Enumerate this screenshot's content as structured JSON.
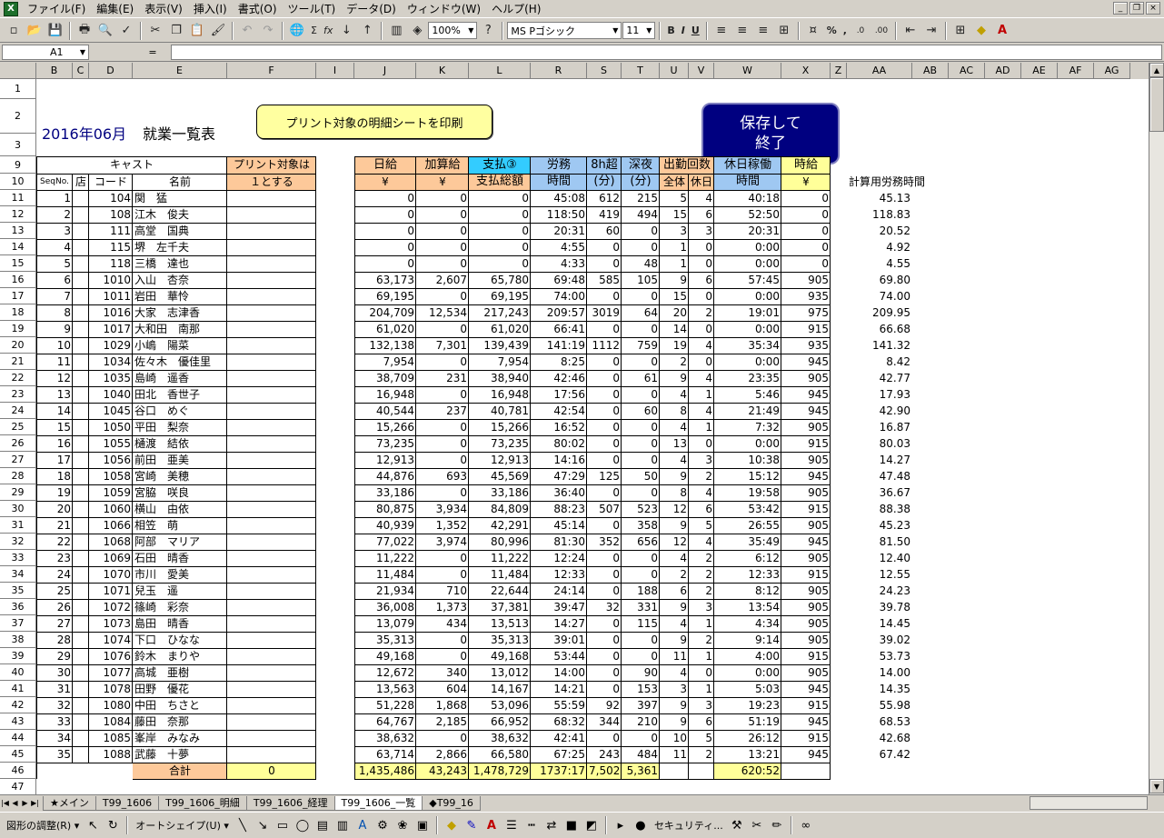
{
  "app": {
    "icon": "excel-app-icon"
  },
  "menu": [
    "ファイル(F)",
    "編集(E)",
    "表示(V)",
    "挿入(I)",
    "書式(O)",
    "ツール(T)",
    "データ(D)",
    "ウィンドウ(W)",
    "ヘルプ(H)"
  ],
  "window_controls": [
    "_",
    "❐",
    "×"
  ],
  "toolbar": {
    "zoom": "100%",
    "font": "MS Pゴシック",
    "size": "11",
    "bold": "B",
    "italic": "I",
    "underline": "U",
    "percent": "%",
    "comma": ",",
    "sigma": "Σ",
    "fx": "fx",
    "help": "?"
  },
  "formula_bar": {
    "name_box": "A1",
    "equals": "="
  },
  "columns": [
    "B",
    "C",
    "D",
    "E",
    "F",
    "I",
    "J",
    "K",
    "L",
    "R",
    "S",
    "T",
    "U",
    "V",
    "W",
    "X",
    "Z",
    "AA",
    "AB",
    "AC",
    "AD",
    "AE",
    "AF",
    "AG"
  ],
  "rows": [
    "1",
    "2",
    "3",
    "9",
    "10",
    "11",
    "12",
    "13",
    "14",
    "15",
    "16",
    "17",
    "18",
    "19",
    "20",
    "21",
    "22",
    "23",
    "24",
    "25",
    "26",
    "27",
    "28",
    "29",
    "30",
    "31",
    "32",
    "33",
    "34",
    "35",
    "36",
    "37",
    "38",
    "39",
    "40",
    "41",
    "42",
    "43",
    "44",
    "45",
    "46",
    "47"
  ],
  "title": {
    "date": "2016年06月",
    "label": "就業一覧表"
  },
  "print_button": "プリント対象の明細シートを印刷",
  "save_button": {
    "line1": "保存して",
    "line2": "終了"
  },
  "headers": {
    "cast": "キャスト",
    "seq": "SeqNo.",
    "store": "店",
    "code": "コード",
    "name": "名前",
    "print1": "プリント対象は",
    "print2": "１とする",
    "daily1": "日給",
    "daily2": "¥",
    "add1": "加算給",
    "add2": "¥",
    "pay1": "支払③",
    "pay2": "支払総額",
    "labor1": "労務",
    "labor2": "時間",
    "over1": "8h超",
    "over2": "(分)",
    "night1": "深夜",
    "night2": "(分)",
    "att1": "出勤回数",
    "att_all": "全体",
    "att_hol": "休日",
    "holwork1": "休日稼働",
    "holwork2": "時間",
    "hourly1": "時給",
    "hourly2": "¥",
    "calc": "計算用労務時間"
  },
  "table_rows": [
    {
      "seq": "1",
      "code": "104",
      "name": "関　猛",
      "daily": "0",
      "add": "0",
      "pay": "0",
      "labor": "45:08",
      "over": "612",
      "night": "215",
      "all": "5",
      "hol": "4",
      "holwork": "40:18",
      "hourly": "0",
      "calc": "45.13"
    },
    {
      "seq": "2",
      "code": "108",
      "name": "江木　俊夫",
      "daily": "0",
      "add": "0",
      "pay": "0",
      "labor": "118:50",
      "over": "419",
      "night": "494",
      "all": "15",
      "hol": "6",
      "holwork": "52:50",
      "hourly": "0",
      "calc": "118.83"
    },
    {
      "seq": "3",
      "code": "111",
      "name": "高堂　国典",
      "daily": "0",
      "add": "0",
      "pay": "0",
      "labor": "20:31",
      "over": "60",
      "night": "0",
      "all": "3",
      "hol": "3",
      "holwork": "20:31",
      "hourly": "0",
      "calc": "20.52"
    },
    {
      "seq": "4",
      "code": "115",
      "name": "堺　左千夫",
      "daily": "0",
      "add": "0",
      "pay": "0",
      "labor": "4:55",
      "over": "0",
      "night": "0",
      "all": "1",
      "hol": "0",
      "holwork": "0:00",
      "hourly": "0",
      "calc": "4.92"
    },
    {
      "seq": "5",
      "code": "118",
      "name": "三橋　達也",
      "daily": "0",
      "add": "0",
      "pay": "0",
      "labor": "4:33",
      "over": "0",
      "night": "48",
      "all": "1",
      "hol": "0",
      "holwork": "0:00",
      "hourly": "0",
      "calc": "4.55"
    },
    {
      "seq": "6",
      "code": "1010",
      "name": "入山　杏奈",
      "daily": "63,173",
      "add": "2,607",
      "pay": "65,780",
      "labor": "69:48",
      "over": "585",
      "night": "105",
      "all": "9",
      "hol": "6",
      "holwork": "57:45",
      "hourly": "905",
      "calc": "69.80"
    },
    {
      "seq": "7",
      "code": "1011",
      "name": "岩田　華怜",
      "daily": "69,195",
      "add": "0",
      "pay": "69,195",
      "labor": "74:00",
      "over": "0",
      "night": "0",
      "all": "15",
      "hol": "0",
      "holwork": "0:00",
      "hourly": "935",
      "calc": "74.00"
    },
    {
      "seq": "8",
      "code": "1016",
      "name": "大家　志津香",
      "daily": "204,709",
      "add": "12,534",
      "pay": "217,243",
      "labor": "209:57",
      "over": "3019",
      "night": "64",
      "all": "20",
      "hol": "2",
      "holwork": "19:01",
      "hourly": "975",
      "calc": "209.95"
    },
    {
      "seq": "9",
      "code": "1017",
      "name": "大和田　南那",
      "daily": "61,020",
      "add": "0",
      "pay": "61,020",
      "labor": "66:41",
      "over": "0",
      "night": "0",
      "all": "14",
      "hol": "0",
      "holwork": "0:00",
      "hourly": "915",
      "calc": "66.68"
    },
    {
      "seq": "10",
      "code": "1029",
      "name": "小嶋　陽菜",
      "daily": "132,138",
      "add": "7,301",
      "pay": "139,439",
      "labor": "141:19",
      "over": "1112",
      "night": "759",
      "all": "19",
      "hol": "4",
      "holwork": "35:34",
      "hourly": "935",
      "calc": "141.32"
    },
    {
      "seq": "11",
      "code": "1034",
      "name": "佐々木　優佳里",
      "daily": "7,954",
      "add": "0",
      "pay": "7,954",
      "labor": "8:25",
      "over": "0",
      "night": "0",
      "all": "2",
      "hol": "0",
      "holwork": "0:00",
      "hourly": "945",
      "calc": "8.42"
    },
    {
      "seq": "12",
      "code": "1035",
      "name": "島崎　遥香",
      "daily": "38,709",
      "add": "231",
      "pay": "38,940",
      "labor": "42:46",
      "over": "0",
      "night": "61",
      "all": "9",
      "hol": "4",
      "holwork": "23:35",
      "hourly": "905",
      "calc": "42.77"
    },
    {
      "seq": "13",
      "code": "1040",
      "name": "田北　香世子",
      "daily": "16,948",
      "add": "0",
      "pay": "16,948",
      "labor": "17:56",
      "over": "0",
      "night": "0",
      "all": "4",
      "hol": "1",
      "holwork": "5:46",
      "hourly": "945",
      "calc": "17.93"
    },
    {
      "seq": "14",
      "code": "1045",
      "name": "谷口　めぐ",
      "daily": "40,544",
      "add": "237",
      "pay": "40,781",
      "labor": "42:54",
      "over": "0",
      "night": "60",
      "all": "8",
      "hol": "4",
      "holwork": "21:49",
      "hourly": "945",
      "calc": "42.90"
    },
    {
      "seq": "15",
      "code": "1050",
      "name": "平田　梨奈",
      "daily": "15,266",
      "add": "0",
      "pay": "15,266",
      "labor": "16:52",
      "over": "0",
      "night": "0",
      "all": "4",
      "hol": "1",
      "holwork": "7:32",
      "hourly": "905",
      "calc": "16.87"
    },
    {
      "seq": "16",
      "code": "1055",
      "name": "樋渡　結依",
      "daily": "73,235",
      "add": "0",
      "pay": "73,235",
      "labor": "80:02",
      "over": "0",
      "night": "0",
      "all": "13",
      "hol": "0",
      "holwork": "0:00",
      "hourly": "915",
      "calc": "80.03"
    },
    {
      "seq": "17",
      "code": "1056",
      "name": "前田　亜美",
      "daily": "12,913",
      "add": "0",
      "pay": "12,913",
      "labor": "14:16",
      "over": "0",
      "night": "0",
      "all": "4",
      "hol": "3",
      "holwork": "10:38",
      "hourly": "905",
      "calc": "14.27"
    },
    {
      "seq": "18",
      "code": "1058",
      "name": "宮崎　美穂",
      "daily": "44,876",
      "add": "693",
      "pay": "45,569",
      "labor": "47:29",
      "over": "125",
      "night": "50",
      "all": "9",
      "hol": "2",
      "holwork": "15:12",
      "hourly": "945",
      "calc": "47.48"
    },
    {
      "seq": "19",
      "code": "1059",
      "name": "宮脇　咲良",
      "daily": "33,186",
      "add": "0",
      "pay": "33,186",
      "labor": "36:40",
      "over": "0",
      "night": "0",
      "all": "8",
      "hol": "4",
      "holwork": "19:58",
      "hourly": "905",
      "calc": "36.67"
    },
    {
      "seq": "20",
      "code": "1060",
      "name": "横山　由依",
      "daily": "80,875",
      "add": "3,934",
      "pay": "84,809",
      "labor": "88:23",
      "over": "507",
      "night": "523",
      "all": "12",
      "hol": "6",
      "holwork": "53:42",
      "hourly": "915",
      "calc": "88.38"
    },
    {
      "seq": "21",
      "code": "1066",
      "name": "相笠　萌",
      "daily": "40,939",
      "add": "1,352",
      "pay": "42,291",
      "labor": "45:14",
      "over": "0",
      "night": "358",
      "all": "9",
      "hol": "5",
      "holwork": "26:55",
      "hourly": "905",
      "calc": "45.23"
    },
    {
      "seq": "22",
      "code": "1068",
      "name": "阿部　マリア",
      "daily": "77,022",
      "add": "3,974",
      "pay": "80,996",
      "labor": "81:30",
      "over": "352",
      "night": "656",
      "all": "12",
      "hol": "4",
      "holwork": "35:49",
      "hourly": "945",
      "calc": "81.50"
    },
    {
      "seq": "23",
      "code": "1069",
      "name": "石田　晴香",
      "daily": "11,222",
      "add": "0",
      "pay": "11,222",
      "labor": "12:24",
      "over": "0",
      "night": "0",
      "all": "4",
      "hol": "2",
      "holwork": "6:12",
      "hourly": "905",
      "calc": "12.40"
    },
    {
      "seq": "24",
      "code": "1070",
      "name": "市川　愛美",
      "daily": "11,484",
      "add": "0",
      "pay": "11,484",
      "labor": "12:33",
      "over": "0",
      "night": "0",
      "all": "2",
      "hol": "2",
      "holwork": "12:33",
      "hourly": "915",
      "calc": "12.55"
    },
    {
      "seq": "25",
      "code": "1071",
      "name": "兒玉　遥",
      "daily": "21,934",
      "add": "710",
      "pay": "22,644",
      "labor": "24:14",
      "over": "0",
      "night": "188",
      "all": "6",
      "hol": "2",
      "holwork": "8:12",
      "hourly": "905",
      "calc": "24.23"
    },
    {
      "seq": "26",
      "code": "1072",
      "name": "篠崎　彩奈",
      "daily": "36,008",
      "add": "1,373",
      "pay": "37,381",
      "labor": "39:47",
      "over": "32",
      "night": "331",
      "all": "9",
      "hol": "3",
      "holwork": "13:54",
      "hourly": "905",
      "calc": "39.78"
    },
    {
      "seq": "27",
      "code": "1073",
      "name": "島田　晴香",
      "daily": "13,079",
      "add": "434",
      "pay": "13,513",
      "labor": "14:27",
      "over": "0",
      "night": "115",
      "all": "4",
      "hol": "1",
      "holwork": "4:34",
      "hourly": "905",
      "calc": "14.45"
    },
    {
      "seq": "28",
      "code": "1074",
      "name": "下口　ひなな",
      "daily": "35,313",
      "add": "0",
      "pay": "35,313",
      "labor": "39:01",
      "over": "0",
      "night": "0",
      "all": "9",
      "hol": "2",
      "holwork": "9:14",
      "hourly": "905",
      "calc": "39.02"
    },
    {
      "seq": "29",
      "code": "1076",
      "name": "鈴木　まりや",
      "daily": "49,168",
      "add": "0",
      "pay": "49,168",
      "labor": "53:44",
      "over": "0",
      "night": "0",
      "all": "11",
      "hol": "1",
      "holwork": "4:00",
      "hourly": "915",
      "calc": "53.73"
    },
    {
      "seq": "30",
      "code": "1077",
      "name": "高城　亜樹",
      "daily": "12,672",
      "add": "340",
      "pay": "13,012",
      "labor": "14:00",
      "over": "0",
      "night": "90",
      "all": "4",
      "hol": "0",
      "holwork": "0:00",
      "hourly": "905",
      "calc": "14.00"
    },
    {
      "seq": "31",
      "code": "1078",
      "name": "田野　優花",
      "daily": "13,563",
      "add": "604",
      "pay": "14,167",
      "labor": "14:21",
      "over": "0",
      "night": "153",
      "all": "3",
      "hol": "1",
      "holwork": "5:03",
      "hourly": "945",
      "calc": "14.35"
    },
    {
      "seq": "32",
      "code": "1080",
      "name": "中田　ちさと",
      "daily": "51,228",
      "add": "1,868",
      "pay": "53,096",
      "labor": "55:59",
      "over": "92",
      "night": "397",
      "all": "9",
      "hol": "3",
      "holwork": "19:23",
      "hourly": "915",
      "calc": "55.98"
    },
    {
      "seq": "33",
      "code": "1084",
      "name": "藤田　奈那",
      "daily": "64,767",
      "add": "2,185",
      "pay": "66,952",
      "labor": "68:32",
      "over": "344",
      "night": "210",
      "all": "9",
      "hol": "6",
      "holwork": "51:19",
      "hourly": "945",
      "calc": "68.53"
    },
    {
      "seq": "34",
      "code": "1085",
      "name": "峯岸　みなみ",
      "daily": "38,632",
      "add": "0",
      "pay": "38,632",
      "labor": "42:41",
      "over": "0",
      "night": "0",
      "all": "10",
      "hol": "5",
      "holwork": "26:12",
      "hourly": "915",
      "calc": "42.68"
    },
    {
      "seq": "35",
      "code": "1088",
      "name": "武藤　十夢",
      "daily": "63,714",
      "add": "2,866",
      "pay": "66,580",
      "labor": "67:25",
      "over": "243",
      "night": "484",
      "all": "11",
      "hol": "2",
      "holwork": "13:21",
      "hourly": "945",
      "calc": "67.42"
    }
  ],
  "totals": {
    "label": "合計",
    "print": "0",
    "daily": "1,435,486",
    "add": "43,243",
    "pay": "1,478,729",
    "labor": "1737:17",
    "over": "7,502",
    "night": "5,361",
    "holwork": "620:52"
  },
  "sheet_tabs": [
    "★メイン",
    "T99_1606",
    "T99_1606_明細",
    "T99_1606_経理",
    "T99_1606_一覧",
    "◆T99_16"
  ],
  "active_tab": 4,
  "drawing_toolbar": {
    "adjust": "図形の調整(R)",
    "autoshape": "オートシェイプ(U)",
    "security": "セキュリティ..."
  },
  "colors": {
    "header_orange": "#fdc99a",
    "header_blue": "#9fc8f2",
    "header_cyan": "#33ccff",
    "header_yellow": "#ffff99",
    "save_navy": "#000080",
    "print_yellow": "#ffffa0"
  }
}
